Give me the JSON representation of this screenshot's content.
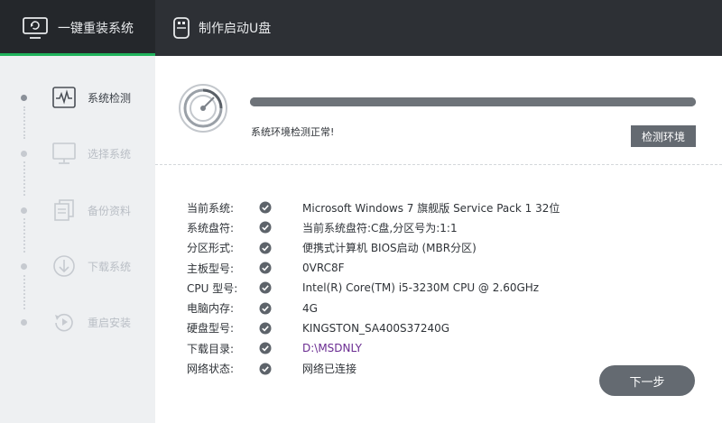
{
  "top_tabs": [
    {
      "label": "一键重装系统",
      "icon": "monitor-refresh-icon",
      "active": true
    },
    {
      "label": "制作启动U盘",
      "icon": "usb-drive-icon",
      "active": false
    }
  ],
  "steps": [
    {
      "label": "系统检测",
      "icon": "pulse-monitor-icon",
      "active": true
    },
    {
      "label": "选择系统",
      "icon": "monitor-icon",
      "active": false
    },
    {
      "label": "备份资料",
      "icon": "documents-icon",
      "active": false
    },
    {
      "label": "下载系统",
      "icon": "download-icon",
      "active": false
    },
    {
      "label": "重启安装",
      "icon": "restart-icon",
      "active": false
    }
  ],
  "detect": {
    "progress": 1.0,
    "status": "系统环境检测正常!",
    "button_label": "检测环境"
  },
  "system_info": [
    {
      "key": "当前系统:",
      "value": "Microsoft Windows 7 旗舰版 Service Pack 1 32位"
    },
    {
      "key": "系统盘符:",
      "value": "当前系统盘符:C盘,分区号为:1:1"
    },
    {
      "key": "分区形式:",
      "value": "便携式计算机 BIOS启动 (MBR分区)"
    },
    {
      "key": "主板型号:",
      "value": "0VRC8F"
    },
    {
      "key": "CPU 型号:",
      "value": "Intel(R) Core(TM) i5-3230M CPU @ 2.60GHz"
    },
    {
      "key": "电脑内存:",
      "value": "4G"
    },
    {
      "key": "硬盘型号:",
      "value": "KINGSTON_SA400S37240G"
    },
    {
      "key": "下载目录:",
      "value": "D:\\MSDNLY"
    },
    {
      "key": "网络状态:",
      "value": "网络已连接"
    }
  ],
  "next_label": "下一步",
  "colors": {
    "accent": "#1fb35c",
    "topbar": "#2d3035",
    "button": "#646a71",
    "link": "#6a2c91"
  }
}
